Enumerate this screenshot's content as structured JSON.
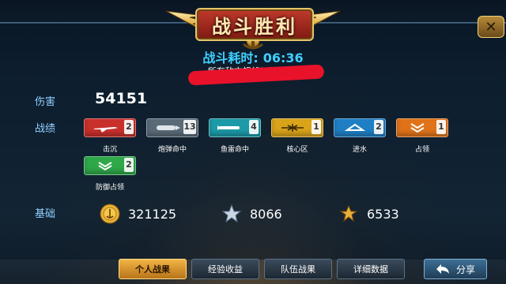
{
  "header": {
    "title": "战斗胜利",
    "close_icon": "close-icon"
  },
  "battle": {
    "time_label": "战斗耗时:",
    "time_value": "06:36",
    "subtitle": "所有敌方舰船已被击沉!"
  },
  "labels": {
    "damage": "伤害",
    "achievements": "战绩",
    "base": "基础"
  },
  "damage_value": "54151",
  "achievements": [
    {
      "caption": "击沉",
      "count": "2",
      "color": "#c9302c",
      "icon": "plane-icon"
    },
    {
      "caption": "炮弹命中",
      "count": "13",
      "color": "#5a6b78",
      "icon": "shell-icon"
    },
    {
      "caption": "鱼雷命中",
      "count": "4",
      "color": "#1d9aa8",
      "icon": "torpedo-icon"
    },
    {
      "caption": "核心区",
      "count": "1",
      "color": "#d9a31a",
      "icon": "core-icon"
    },
    {
      "caption": "进水",
      "count": "2",
      "color": "#1f7fc4",
      "icon": "flood-icon"
    },
    {
      "caption": "占领",
      "count": "1",
      "color": "#e0731a",
      "icon": "capture-icon"
    },
    {
      "caption": "防御占领",
      "count": "2",
      "color": "#2fa84a",
      "icon": "defend-icon"
    }
  ],
  "base_rewards": [
    {
      "name": "coins",
      "value": "321125",
      "icon": "coin-icon"
    },
    {
      "name": "experience",
      "value": "8066",
      "icon": "star-icon"
    },
    {
      "name": "captain_exp",
      "value": "6533",
      "icon": "winged-star-icon"
    }
  ],
  "tabs": [
    {
      "label": "个人战果",
      "active": true
    },
    {
      "label": "经验收益",
      "active": false
    },
    {
      "label": "队伍战果",
      "active": false
    },
    {
      "label": "详细数据",
      "active": false
    }
  ],
  "share": {
    "label": "分享",
    "icon": "back-arrow-icon"
  }
}
